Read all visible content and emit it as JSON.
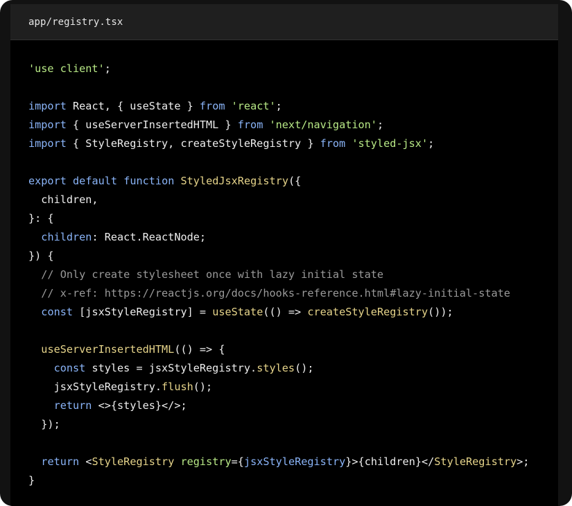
{
  "file": {
    "name": "app/registry.tsx"
  },
  "code": {
    "lines": [
      [
        {
          "t": "'use client'",
          "c": "str"
        },
        {
          "t": ";",
          "c": "pl"
        }
      ],
      [],
      [
        {
          "t": "import",
          "c": "kw"
        },
        {
          "t": " React, { useState } ",
          "c": "pl"
        },
        {
          "t": "from",
          "c": "kw"
        },
        {
          "t": " ",
          "c": "pl"
        },
        {
          "t": "'react'",
          "c": "str"
        },
        {
          "t": ";",
          "c": "pl"
        }
      ],
      [
        {
          "t": "import",
          "c": "kw"
        },
        {
          "t": " { useServerInsertedHTML } ",
          "c": "pl"
        },
        {
          "t": "from",
          "c": "kw"
        },
        {
          "t": " ",
          "c": "pl"
        },
        {
          "t": "'next/navigation'",
          "c": "str"
        },
        {
          "t": ";",
          "c": "pl"
        }
      ],
      [
        {
          "t": "import",
          "c": "kw"
        },
        {
          "t": " { StyleRegistry, createStyleRegistry } ",
          "c": "pl"
        },
        {
          "t": "from",
          "c": "kw"
        },
        {
          "t": " ",
          "c": "pl"
        },
        {
          "t": "'styled-jsx'",
          "c": "str"
        },
        {
          "t": ";",
          "c": "pl"
        }
      ],
      [],
      [
        {
          "t": "export",
          "c": "kw"
        },
        {
          "t": " ",
          "c": "pl"
        },
        {
          "t": "default",
          "c": "kw"
        },
        {
          "t": " ",
          "c": "pl"
        },
        {
          "t": "function",
          "c": "kw"
        },
        {
          "t": " ",
          "c": "pl"
        },
        {
          "t": "StyledJsxRegistry",
          "c": "fn"
        },
        {
          "t": "({",
          "c": "pl"
        }
      ],
      [
        {
          "t": "  children,",
          "c": "pl"
        }
      ],
      [
        {
          "t": "}: {",
          "c": "pl"
        }
      ],
      [
        {
          "t": "  ",
          "c": "pl"
        },
        {
          "t": "children",
          "c": "prop"
        },
        {
          "t": ": React.ReactNode;",
          "c": "pl"
        }
      ],
      [
        {
          "t": "}) {",
          "c": "pl"
        }
      ],
      [
        {
          "t": "  // Only create stylesheet once with lazy initial state",
          "c": "cm"
        }
      ],
      [
        {
          "t": "  // x-ref: https://reactjs.org/docs/hooks-reference.html#lazy-initial-state",
          "c": "cm"
        }
      ],
      [
        {
          "t": "  ",
          "c": "pl"
        },
        {
          "t": "const",
          "c": "kw"
        },
        {
          "t": " [jsxStyleRegistry] = ",
          "c": "pl"
        },
        {
          "t": "useState",
          "c": "fn"
        },
        {
          "t": "(() => ",
          "c": "pl"
        },
        {
          "t": "createStyleRegistry",
          "c": "fn"
        },
        {
          "t": "());",
          "c": "pl"
        }
      ],
      [],
      [
        {
          "t": "  ",
          "c": "pl"
        },
        {
          "t": "useServerInsertedHTML",
          "c": "fn"
        },
        {
          "t": "(() => {",
          "c": "pl"
        }
      ],
      [
        {
          "t": "    ",
          "c": "pl"
        },
        {
          "t": "const",
          "c": "kw"
        },
        {
          "t": " styles = jsxStyleRegistry.",
          "c": "pl"
        },
        {
          "t": "styles",
          "c": "fn"
        },
        {
          "t": "();",
          "c": "pl"
        }
      ],
      [
        {
          "t": "    jsxStyleRegistry.",
          "c": "pl"
        },
        {
          "t": "flush",
          "c": "fn"
        },
        {
          "t": "();",
          "c": "pl"
        }
      ],
      [
        {
          "t": "    ",
          "c": "pl"
        },
        {
          "t": "return",
          "c": "kw"
        },
        {
          "t": " <>{styles}</>;",
          "c": "pl"
        }
      ],
      [
        {
          "t": "  });",
          "c": "pl"
        }
      ],
      [],
      [
        {
          "t": "  ",
          "c": "pl"
        },
        {
          "t": "return",
          "c": "kw"
        },
        {
          "t": " <",
          "c": "pl"
        },
        {
          "t": "StyleRegistry",
          "c": "fn"
        },
        {
          "t": " ",
          "c": "pl"
        },
        {
          "t": "registry",
          "c": "attr"
        },
        {
          "t": "={",
          "c": "pl"
        },
        {
          "t": "jsxStyleRegistry",
          "c": "prop"
        },
        {
          "t": "}>{children}</",
          "c": "pl"
        },
        {
          "t": "StyleRegistry",
          "c": "fn"
        },
        {
          "t": ">;",
          "c": "pl"
        }
      ],
      [
        {
          "t": "}",
          "c": "pl"
        }
      ]
    ]
  }
}
